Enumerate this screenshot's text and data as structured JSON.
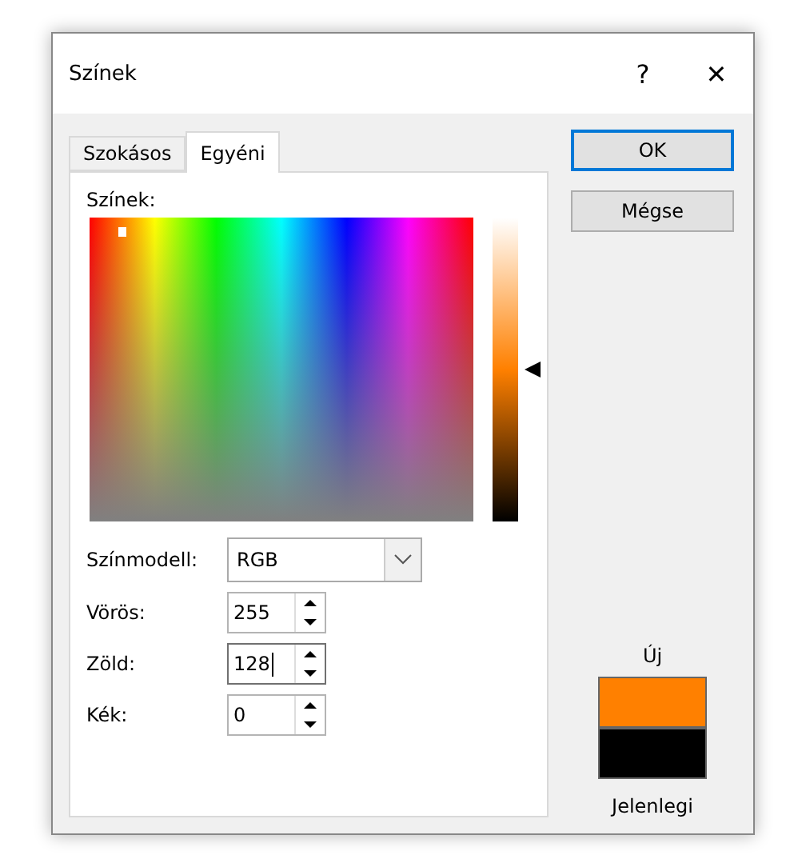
{
  "window": {
    "title": "Színek",
    "help": "?",
    "close": "✕"
  },
  "tabs": [
    {
      "label": "Szokásos",
      "selected": false
    },
    {
      "label": "Egyéni",
      "selected": true
    }
  ],
  "colors_label": "Színek:",
  "luminance": {
    "level": 0.5
  },
  "color_model": {
    "label": "Színmodell:",
    "value": "RGB"
  },
  "channels": [
    {
      "label": "Vörös:",
      "value": "255",
      "focused": false
    },
    {
      "label": "Zöld:",
      "value": "128",
      "focused": true
    },
    {
      "label": "Kék:",
      "value": "0",
      "focused": false
    }
  ],
  "buttons": [
    {
      "label": "OK",
      "default": true
    },
    {
      "label": "Mégse",
      "default": false
    }
  ],
  "preview": {
    "new_label": "Új",
    "current_label": "Jelenlegi",
    "swatches": [
      {
        "color": "#ff8000"
      },
      {
        "color": "#000000"
      }
    ]
  }
}
